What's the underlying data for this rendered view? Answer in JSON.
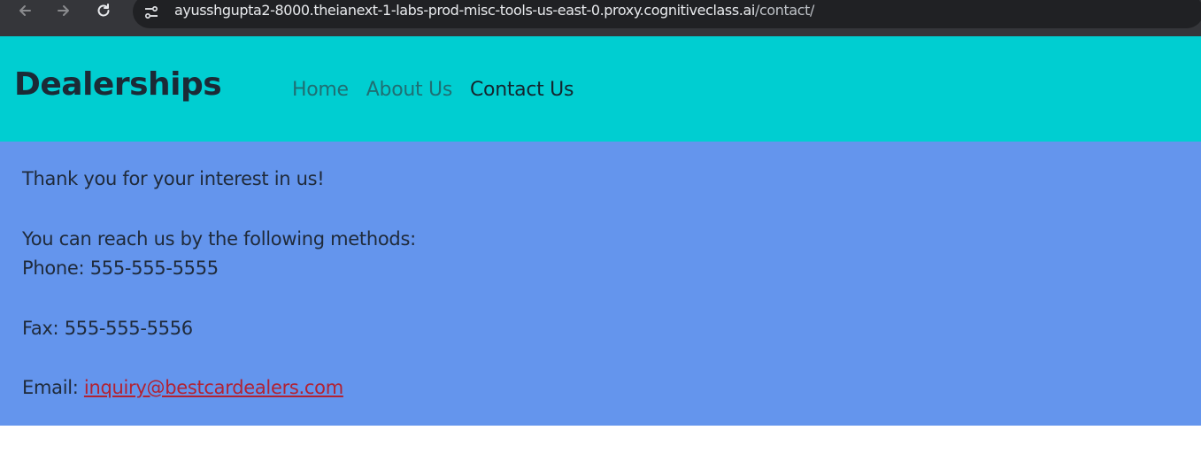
{
  "browser": {
    "url_host": "ayusshgupta2-8000.theianext-1-labs-prod-misc-tools-us-east-0.proxy.cognitiveclass.ai",
    "url_path": "/contact/",
    "icons": [
      "back-arrow-icon",
      "forward-arrow-icon",
      "reload-icon",
      "site-info-icon"
    ]
  },
  "navbar": {
    "brand": "Dealerships",
    "links": [
      {
        "label": "Home"
      },
      {
        "label": "About Us"
      },
      {
        "label": "Contact Us"
      }
    ],
    "background": "#00ced1"
  },
  "content": {
    "background": "#6495ed",
    "thanks": "Thank you for your interest in us!",
    "reach": "You can reach us by the following methods:",
    "phone": "Phone: 555-555-5555",
    "fax": "Fax: 555-555-5556",
    "email_label": "Email: ",
    "email_link": "inquiry@bestcardealers.com"
  }
}
